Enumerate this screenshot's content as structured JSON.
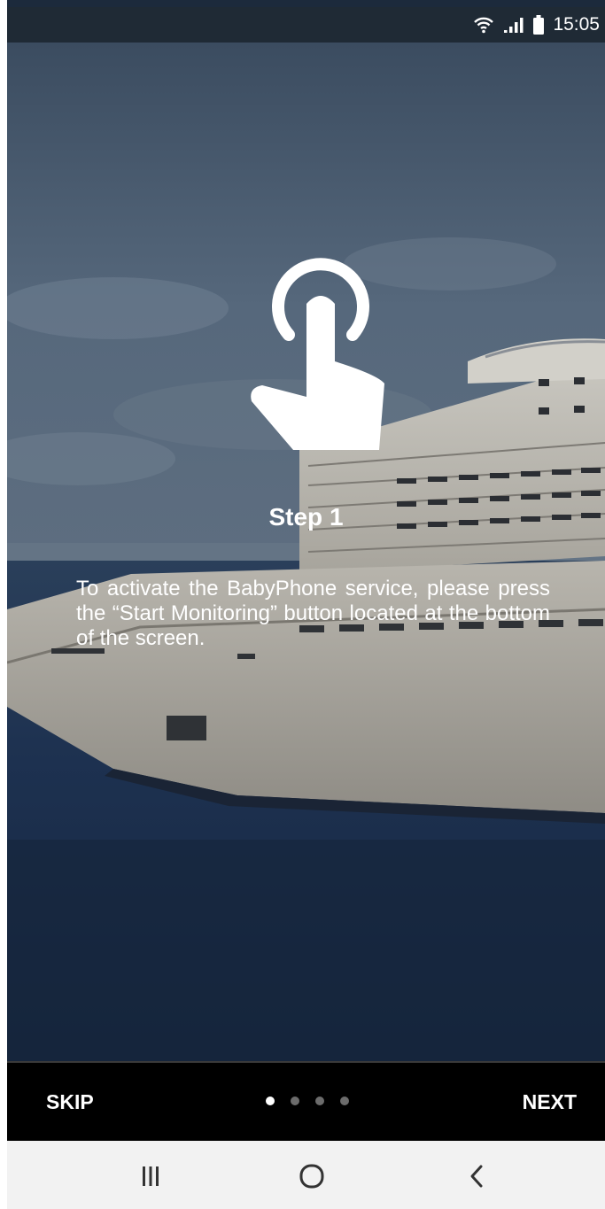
{
  "status_bar": {
    "time": "15:05",
    "icons": [
      "wifi-icon",
      "signal-icon",
      "battery-icon"
    ]
  },
  "onboarding": {
    "step_title": "Step 1",
    "step_text": "To activate the BabyPhone service, please press the “Start Monitoring” button located at the bottom of the screen.",
    "icon": "touch-hand-icon"
  },
  "bottom_bar": {
    "skip_label": "SKIP",
    "next_label": "NEXT",
    "page_count": 4,
    "active_page": 1
  },
  "system_nav": {
    "icons": [
      "recents-icon",
      "home-icon",
      "back-icon"
    ]
  },
  "colors": {
    "status_bar": "#1f2a35",
    "bottom_bar": "#000000",
    "system_nav": "#f2f2f2",
    "text": "#ffffff"
  }
}
